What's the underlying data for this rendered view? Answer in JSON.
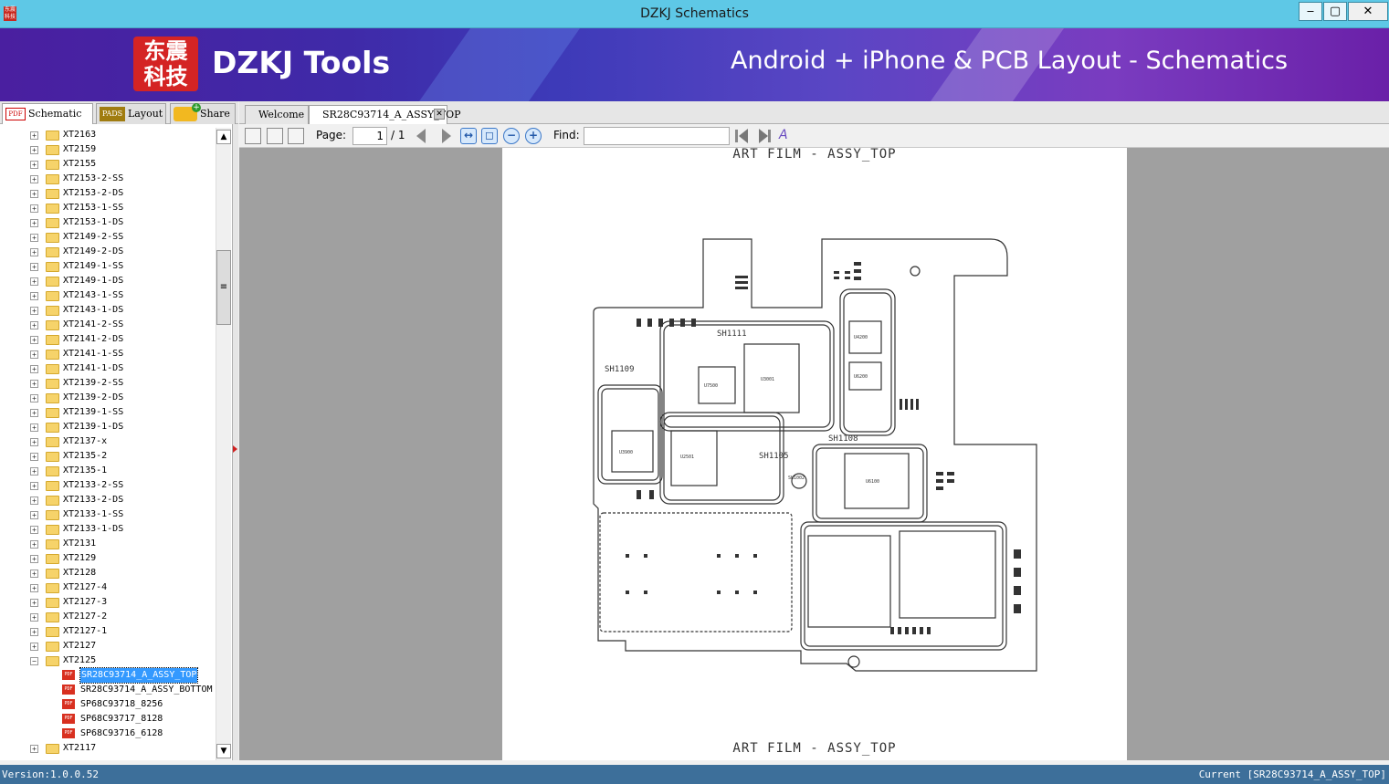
{
  "window": {
    "title": "DZKJ Schematics",
    "minimize": "‒",
    "maximize": "▢",
    "close": "✕",
    "icon_text": "东震科技"
  },
  "banner": {
    "logo_text": "东震科技",
    "brand": "DZKJ Tools",
    "tagline": "Android + iPhone & PCB Layout - Schematics"
  },
  "left_tabs": [
    {
      "label": "Schematic",
      "icon": "pdf-icon",
      "icon_text": "PDF"
    },
    {
      "label": "Layout",
      "icon": "pads-icon",
      "icon_text": "PADS"
    },
    {
      "label": "Share",
      "icon": "share-icon"
    }
  ],
  "doc_tabs": [
    {
      "label": "Welcome"
    },
    {
      "label": "SR28C93714_A_ASSY_TOP"
    }
  ],
  "tree": {
    "folders": [
      "XT2163",
      "XT2159",
      "XT2155",
      "XT2153-2-SS",
      "XT2153-2-DS",
      "XT2153-1-SS",
      "XT2153-1-DS",
      "XT2149-2-SS",
      "XT2149-2-DS",
      "XT2149-1-SS",
      "XT2149-1-DS",
      "XT2143-1-SS",
      "XT2143-1-DS",
      "XT2141-2-SS",
      "XT2141-2-DS",
      "XT2141-1-SS",
      "XT2141-1-DS",
      "XT2139-2-SS",
      "XT2139-2-DS",
      "XT2139-1-SS",
      "XT2139-1-DS",
      "XT2137-x",
      "XT2135-2",
      "XT2135-1",
      "XT2133-2-SS",
      "XT2133-2-DS",
      "XT2133-1-SS",
      "XT2133-1-DS",
      "XT2131",
      "XT2129",
      "XT2128",
      "XT2127-4",
      "XT2127-3",
      "XT2127-2",
      "XT2127-1",
      "XT2127"
    ],
    "open_folder": "XT2125",
    "files": [
      "SR28C93714_A_ASSY_TOP",
      "SR28C93714_A_ASSY_BOTTOM",
      "SP68C93718_8256",
      "SP68C93717_8128",
      "SP68C93716_6128"
    ],
    "selected_file": "SR28C93714_A_ASSY_TOP",
    "after_folder": "XT2117",
    "file_icon_text": "PDF"
  },
  "toolbar": {
    "page_label": "Page:",
    "page_value": "1",
    "page_total": "/ 1",
    "find_label": "Find:",
    "find_value": ""
  },
  "document": {
    "caption_top": "ART FILM - ASSY_TOP",
    "caption_bottom": "ART FILM - ASSY_TOP",
    "board_labels": [
      "SH1111",
      "SH1109",
      "SH1105",
      "SH1108",
      "SH1002",
      "U3001",
      "U2501",
      "U7500",
      "U3900",
      "U4200",
      "U6200",
      "U6100"
    ]
  },
  "status": {
    "version": "Version:1.0.0.52",
    "current": "Current [SR28C93714_A_ASSY_TOP]"
  },
  "colors": {
    "titlebar": "#5ec8e6",
    "status": "#3d6f9a",
    "selection": "#3399ff",
    "viewer_bg": "#a0a0a0"
  }
}
